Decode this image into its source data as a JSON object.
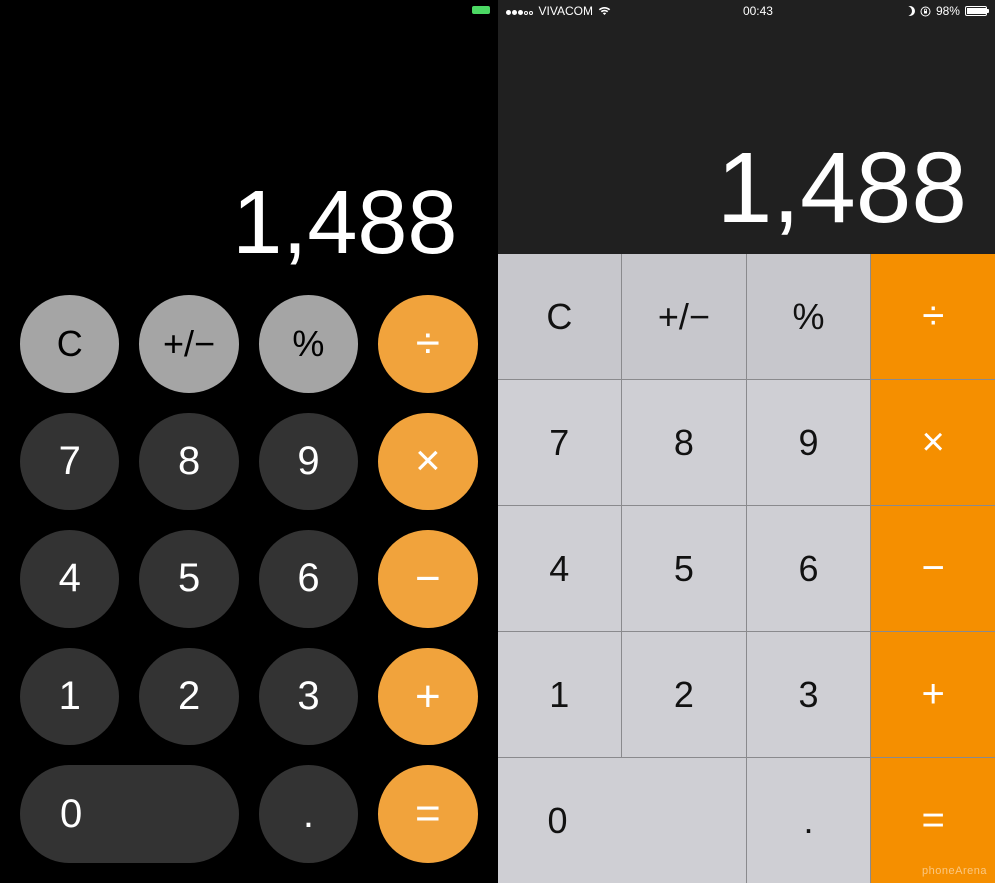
{
  "left": {
    "display": "1,488",
    "buttons": {
      "clear": "C",
      "sign": "+/−",
      "percent": "%",
      "divide": "÷",
      "n7": "7",
      "n8": "8",
      "n9": "9",
      "multiply": "×",
      "n4": "4",
      "n5": "5",
      "n6": "6",
      "minus": "−",
      "n1": "1",
      "n2": "2",
      "n3": "3",
      "plus": "+",
      "n0": "0",
      "decimal": ".",
      "equals": "="
    }
  },
  "right": {
    "statusbar": {
      "carrier": "VIVACOM",
      "time": "00:43",
      "battery_pct": "98%"
    },
    "display": "1,488",
    "buttons": {
      "clear": "C",
      "sign": "+/−",
      "percent": "%",
      "divide": "÷",
      "n7": "7",
      "n8": "8",
      "n9": "9",
      "multiply": "×",
      "n4": "4",
      "n5": "5",
      "n6": "6",
      "minus": "−",
      "n1": "1",
      "n2": "2",
      "n3": "3",
      "plus": "+",
      "n0": "0",
      "decimal": ".",
      "equals": "="
    },
    "watermark": "phoneArena"
  }
}
